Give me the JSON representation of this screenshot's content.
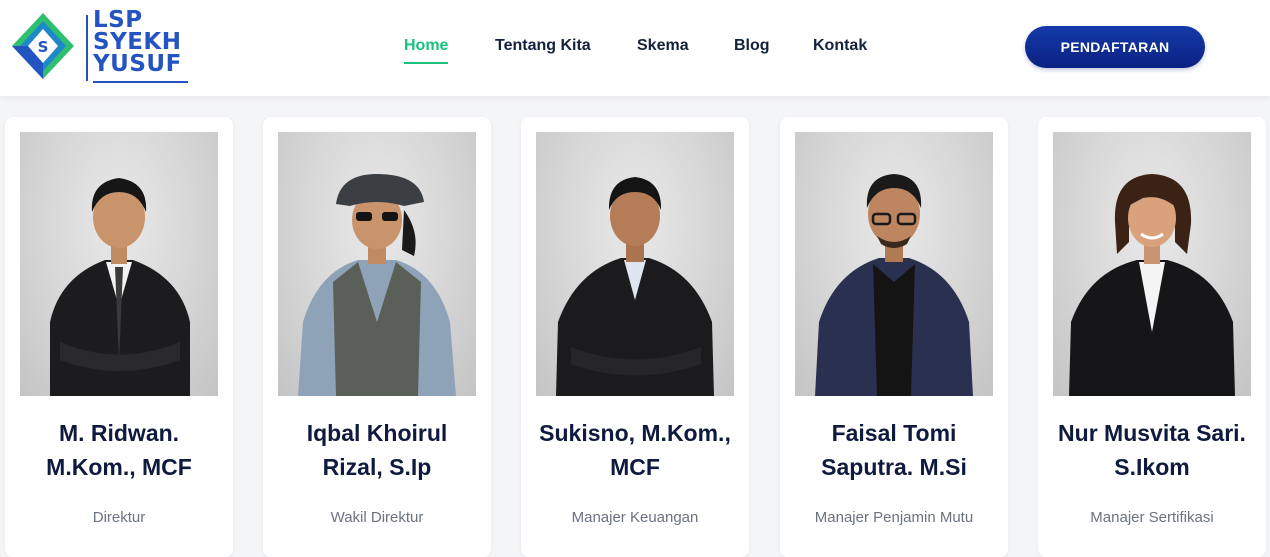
{
  "brand": {
    "line1": "LSP",
    "line2": "SYEKH",
    "line3": "YUSUF",
    "colors": {
      "blue": "#2454c2",
      "green": "#2fbf71",
      "teal": "#1e88c9"
    }
  },
  "nav": {
    "items": [
      {
        "label": "Home",
        "active": true
      },
      {
        "label": "Tentang Kita",
        "active": false
      },
      {
        "label": "Skema",
        "active": false
      },
      {
        "label": "Blog",
        "active": false
      },
      {
        "label": "Kontak",
        "active": false
      }
    ],
    "active_color": "#19c37d",
    "cta_label": "PENDAFTARAN"
  },
  "team": [
    {
      "name_line1": "M. Ridwan.",
      "name_line2": "M.Kom., MCF",
      "role": "Direktur",
      "photo": "man-black-suit-striped-tie"
    },
    {
      "name_line1": "Iqbal Khoirul",
      "name_line2": "Rizal, S.Ip",
      "role": "Wakil Direktur",
      "photo": "man-flat-cap-vest"
    },
    {
      "name_line1": "Sukisno, M.Kom.,",
      "name_line2": "MCF",
      "role": "Manajer Keuangan",
      "photo": "man-black-suit"
    },
    {
      "name_line1": "Faisal Tomi",
      "name_line2": "Saputra. M.Si",
      "role": "Manajer Penjamin Mutu",
      "photo": "man-navy-blazer-glasses"
    },
    {
      "name_line1": "Nur Musvita Sari.",
      "name_line2": "S.Ikom",
      "role": "Manajer Sertifikasi",
      "photo": "woman-black-blazer"
    }
  ]
}
